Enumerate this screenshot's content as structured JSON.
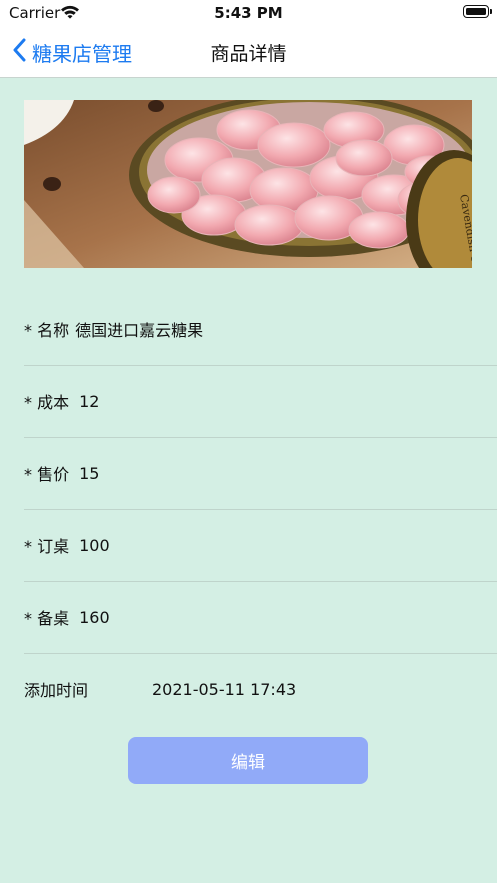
{
  "status": {
    "carrier": "Carrier",
    "time": "5:43 PM"
  },
  "nav": {
    "back_label": "糖果店管理",
    "title": "商品详情"
  },
  "hero_image": {
    "description": "candy-tin-photo",
    "tin_text": "Cavendish & H"
  },
  "fields": [
    {
      "label": "* 名称",
      "value": "德国进口嘉云糖果"
    },
    {
      "label": "* 成本",
      "value": "12"
    },
    {
      "label": "* 售价",
      "value": "15"
    },
    {
      "label": "* 订桌",
      "value": "100"
    },
    {
      "label": "* 备桌",
      "value": "160"
    }
  ],
  "added_time": {
    "label": "添加时间",
    "value": "2021-05-11 17:43"
  },
  "edit_button": {
    "label": "编辑"
  },
  "colors": {
    "accent": "#1d7bf0",
    "background": "#d4efe4",
    "button": "#91aaf8"
  }
}
